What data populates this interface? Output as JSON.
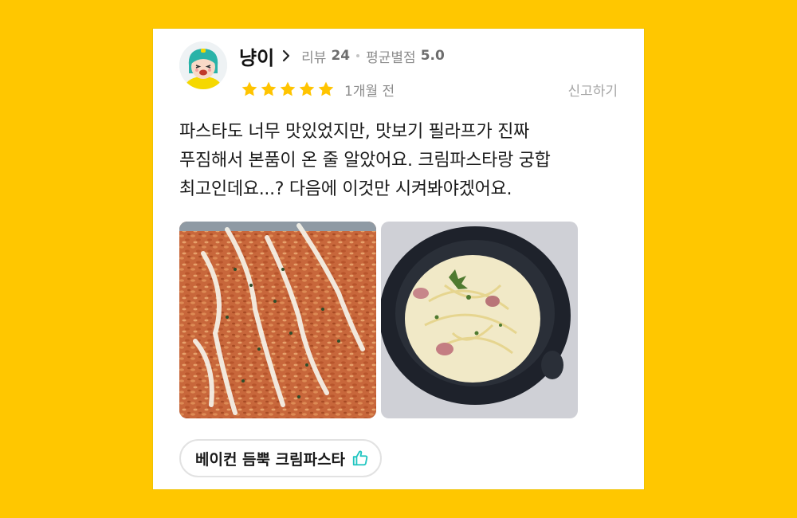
{
  "reviewer": {
    "name": "냥이",
    "review_label": "리뷰",
    "review_count": "24",
    "avg_label": "평균별점",
    "avg_rating": "5.0",
    "avatar_icon": "character-avatar-icon"
  },
  "review": {
    "stars": 5,
    "time_ago": "1개월 전",
    "report_label": "신고하기",
    "lines": [
      "파스타도 너무 맛있었지만, 맛보기 필라프가 진짜",
      "푸짐해서 본품이 온 줄 알았어요. 크림파스타랑 궁합",
      "최고인데요...? 다음에 이것만 시켜봐야겠어요."
    ],
    "photos": [
      "pilaf-photo",
      "cream-pasta-photo"
    ],
    "tag": "베이컨 듬뿍 크림파스타",
    "tag_icon": "thumbs-up-icon"
  },
  "colors": {
    "background": "#FFC700",
    "star": "#FFC400",
    "thumb": "#1fc5c0"
  }
}
